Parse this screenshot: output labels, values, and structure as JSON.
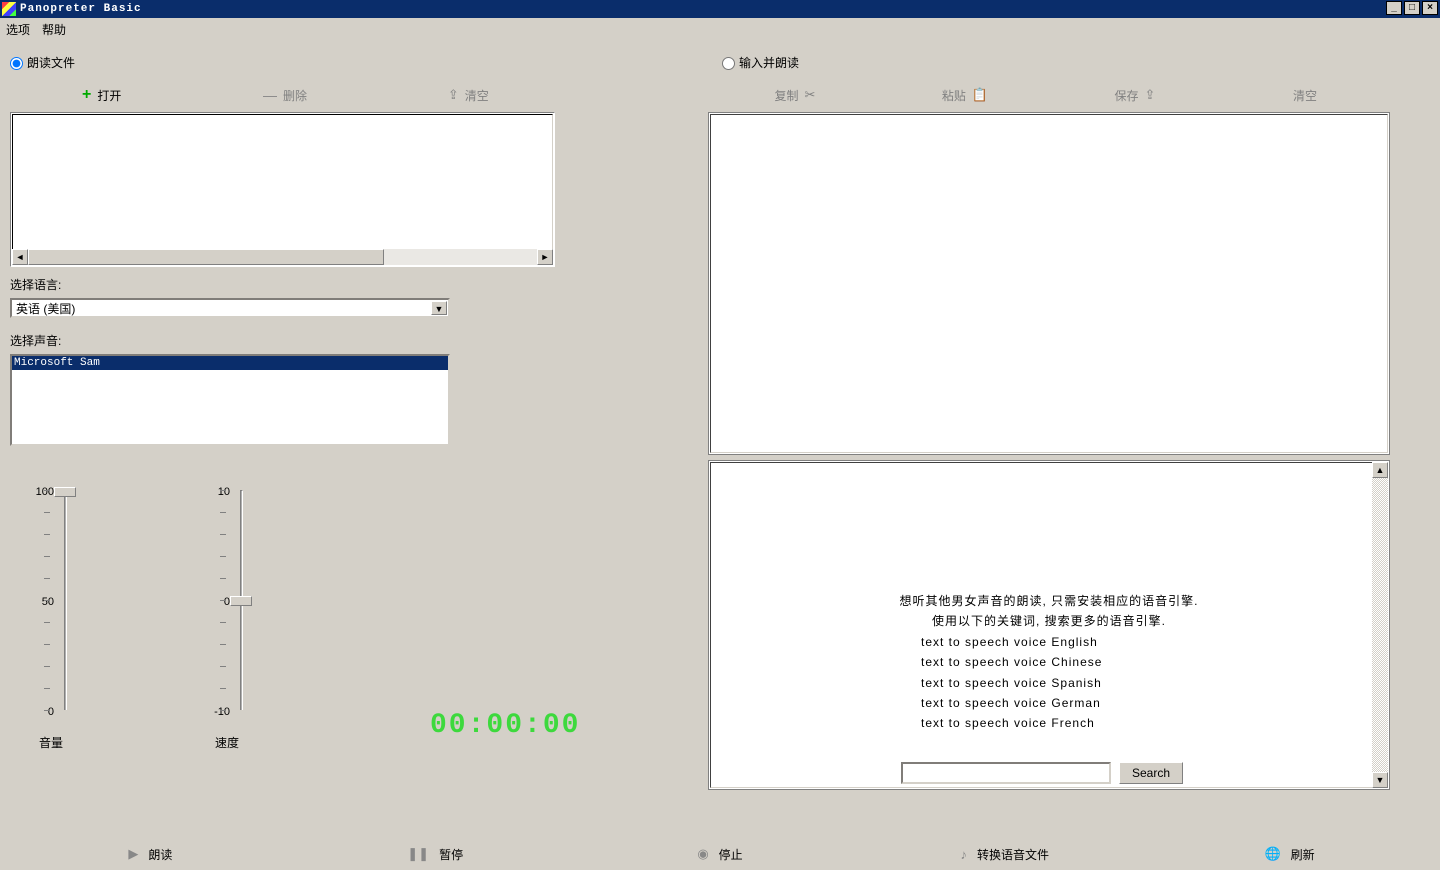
{
  "title": "Panopreter Basic",
  "menu": {
    "options": "选项",
    "help": "帮助"
  },
  "radio": {
    "read_file": "朗读文件",
    "input_and_read": "输入并朗读"
  },
  "toolbar_left": {
    "open": "打开",
    "delete": "删除",
    "clear": "清空"
  },
  "toolbar_right": {
    "copy": "复制",
    "paste": "粘贴",
    "save": "保存",
    "clear": "清空"
  },
  "labels": {
    "select_language": "选择语言:",
    "select_voice": "选择声音:",
    "volume": "音量",
    "speed": "速度"
  },
  "language_selected": "英语 (美国)",
  "voice_selected": "Microsoft Sam",
  "sliders": {
    "volume": {
      "max": "100",
      "mid": "50",
      "min": "0"
    },
    "speed": {
      "max": "10",
      "mid": "0",
      "min": "-10"
    }
  },
  "time": "00:00:00",
  "info": {
    "line1": "想听其他男女声音的朗读, 只需安装相应的语音引擎.",
    "line2": "使用以下的关键词, 搜索更多的语音引擎.",
    "kw1": "text to speech voice English",
    "kw2": "text to speech voice Chinese",
    "kw3": "text to speech voice Spanish",
    "kw4": "text to speech voice German",
    "kw5": "text to speech voice French"
  },
  "search_btn": "Search",
  "bottom": {
    "read": "朗读",
    "pause": "暂停",
    "stop": "停止",
    "convert": "转换语音文件",
    "refresh": "刷新"
  }
}
